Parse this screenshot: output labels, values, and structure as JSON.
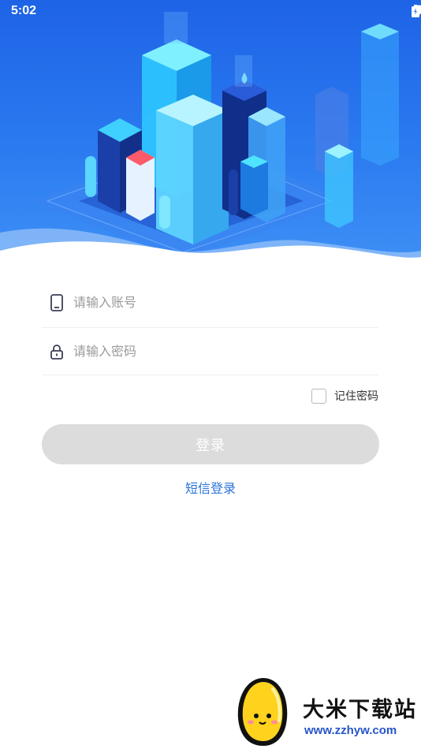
{
  "status_bar": {
    "time": "5:02"
  },
  "login": {
    "account_placeholder": "请输入账号",
    "password_placeholder": "请输入密码",
    "remember_label": "记住密码",
    "login_button": "登录",
    "sms_login": "短信登录"
  },
  "watermark": {
    "title": "大米下载站",
    "url": "www.zzhyw.com"
  },
  "colors": {
    "primary_blue": "#2a72d8",
    "hero_blue": "#1e63e6",
    "button_disabled": "#dcdcdc"
  }
}
